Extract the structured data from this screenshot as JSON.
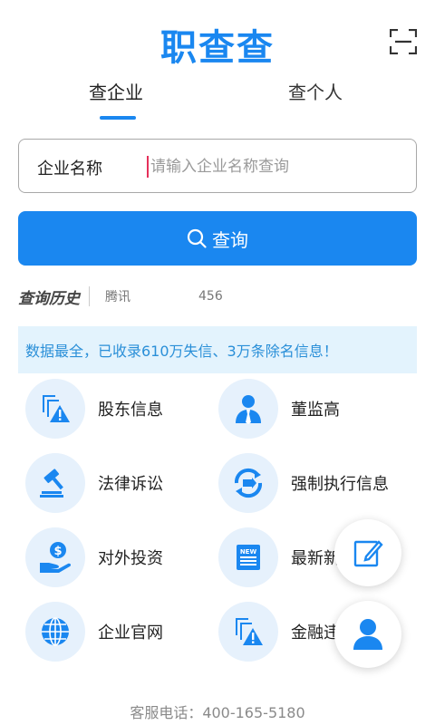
{
  "header": {
    "logo_text": "职查查",
    "scan_icon": "scan-icon"
  },
  "tabs": [
    {
      "label": "查企业",
      "active": true
    },
    {
      "label": "查个人",
      "active": false
    }
  ],
  "search": {
    "label": "企业名称",
    "placeholder": "请输入企业名称查询",
    "value": ""
  },
  "query_button": {
    "label": "查询",
    "icon": "search-icon"
  },
  "history": {
    "title": "查询历史",
    "items": [
      "腾讯",
      "456"
    ]
  },
  "notice": {
    "text": "数据最全，已收录610万失信、3万条除名信息！"
  },
  "features": [
    {
      "label": "股东信息",
      "icon": "shareholder-alert-icon"
    },
    {
      "label": "董监高",
      "icon": "executive-person-icon"
    },
    {
      "label": "法律诉讼",
      "icon": "gavel-icon"
    },
    {
      "label": "强制执行信息",
      "icon": "enforcement-arrows-icon"
    },
    {
      "label": "对外投资",
      "icon": "investment-dollar-icon"
    },
    {
      "label": "最新新",
      "icon": "news-icon"
    },
    {
      "label": "企业官网",
      "icon": "globe-icon"
    },
    {
      "label": "金融违",
      "icon": "finance-alert-icon"
    }
  ],
  "fabs": {
    "edit_icon": "edit-icon",
    "user_icon": "user-icon"
  },
  "footer": {
    "text": "客服电话：400-165-5180"
  },
  "colors": {
    "primary": "#1a87f0",
    "icon_bg": "#e6f1fc",
    "notice_bg": "#e3f3fd",
    "notice_text": "#2a8fd8"
  }
}
